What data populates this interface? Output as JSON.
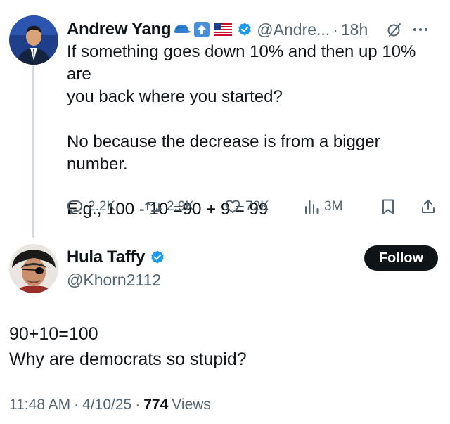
{
  "parent_tweet": {
    "author_name": "Andrew Yang",
    "handle": "@Andre...",
    "separator": "·",
    "time": "18h",
    "text": "If something goes down 10% and then up 10% are\nyou back where you started?\n\nNo because the decrease is from a bigger\nnumber.\n\nE.g., 100 - 10 =90 + 9 = 99",
    "stats": {
      "replies": "2.2K",
      "reposts": "2.9K",
      "likes": "72K",
      "views": "3M"
    }
  },
  "reply_tweet": {
    "author_name": "Hula Taffy",
    "handle": "@Khorn2112",
    "follow_label": "Follow",
    "text": "90+10=100\nWhy are democrats so stupid?",
    "meta": {
      "time": "11:48 AM",
      "sep1": "·",
      "date": "4/10/25",
      "sep2": "·",
      "views_count": "774",
      "views_label": "Views"
    }
  },
  "colors": {
    "verified_blue": "#1d9bf0",
    "muted_gray": "#536471",
    "thread_line": "#cfd9de",
    "follow_bg": "#0f1419"
  }
}
